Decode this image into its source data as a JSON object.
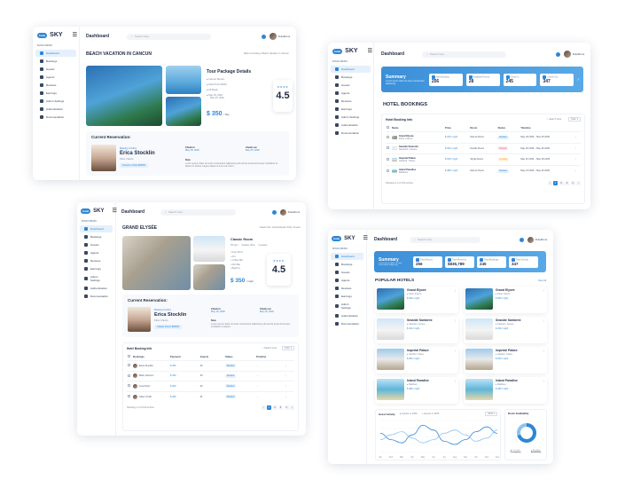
{
  "common": {
    "logo_text": "SKY",
    "logo_badge": "hotel",
    "menu_icon": "☰",
    "nav_title": "MAIN MENU",
    "nav_items": [
      "Dashboard",
      "Bookings",
      "Guests",
      "Agents",
      "Reviews",
      "Earnings",
      "Admin Settings",
      "Authentication",
      "Documentation"
    ],
    "topbar_title": "Dashboard",
    "search_placeholder": "Search here",
    "user_name": "Franklin A."
  },
  "card1": {
    "heading": "BEACH VACATION IN CANCUN",
    "breadcrumb": "Back to booking / Beach Vacation in Cancun",
    "tour_title": "Tour Package Details",
    "details": [
      "Cancun Mexico",
      "Most Price $1600",
      "All Meals",
      "May 18, 2026",
      "May 25, 2026"
    ],
    "rating": "4.5",
    "stars": "★★★★",
    "price": "$ 350",
    "price_unit": "/ Day",
    "reservation_title": "Current Reservation:",
    "guest_tag": "Booking Confirm",
    "guest_name": "Erica Stocklin",
    "guest_loc": "Paris, France",
    "room_btn": "Premium Suite   $350/N",
    "checkin_label": "Check in",
    "checkin_val": "May 18, 2026",
    "checkout_label": "Check out",
    "checkout_val": "May 25, 2026",
    "note_label": "Note",
    "note_text": "Lorem ipsum dolor sit amet consectetur adipiscing elit sed do eiusmod tempor incididunt ut labore et dolore magna aliqua ut enim ad minim."
  },
  "card2": {
    "summary_title": "Summary",
    "summary_sub": "Lorem ipsum dolor sit amet consectetur adipiscing",
    "stats": [
      {
        "label": "New Booking",
        "value": "256"
      },
      {
        "label": "Available Rooms",
        "value": "28"
      },
      {
        "label": "Check In",
        "value": "245"
      },
      {
        "label": "Check Out",
        "value": "347"
      }
    ],
    "section_title": "HOTEL BOOKINGS",
    "table_title": "Hotel Booking Info",
    "search_label": "Search here",
    "filter_label": "Filter",
    "columns": [
      "Name",
      "Price",
      "Room",
      "Status",
      "Timeline"
    ],
    "rows": [
      {
        "name": "Grand Elysée",
        "sub": "Paris, France",
        "price": "$ 320 / night",
        "room": "Deluxe Room",
        "status": "Booked",
        "timeline": "May 18 2026 – May 25 2026"
      },
      {
        "name": "Seaside Santorini",
        "sub": "Santorini, Greece",
        "price": "$ 320 / night",
        "room": "Double Room",
        "status": "Refund",
        "timeline": "May 20 2026 – May 26 2026"
      },
      {
        "name": "Imperial Palace",
        "sub": "Istanbul, Turkey",
        "price": "$ 320 / night",
        "room": "Single Room",
        "status": "Pending",
        "timeline": "May 22 2026 – May 28 2026"
      },
      {
        "name": "Island Paradise",
        "sub": "Maldives",
        "price": "$ 480 / night",
        "room": "Deluxe Room",
        "status": "Booked",
        "timeline": "May 24 2026 – May 30 2026"
      }
    ],
    "showing": "Showing 1-4 of 100 entries",
    "pages": [
      "‹",
      "1",
      "2",
      "3",
      "4",
      "›"
    ]
  },
  "card3": {
    "heading": "GRAND ELYSÉE",
    "breadcrumb": "Hotels Info / Grand Elysée Paris, France",
    "room_title": "Classic Room",
    "room_meta": [
      "35 sqm",
      "Garden View",
      "2 guests"
    ],
    "amenities": [
      "Free Wi-Fi",
      "A/C",
      "Coffee Bar",
      "Mini Bar",
      "Balcony"
    ],
    "rating": "4.5",
    "stars": "★★★★",
    "price": "$ 350",
    "price_unit": "/ night",
    "reservation_title": "Current Reservation:",
    "guest_tag": "Booking Confirm",
    "guest_name": "Erica Stocklin",
    "guest_loc": "Paris, France",
    "room_btn": "Classic Room   $350/N",
    "checkin_label": "Check in",
    "checkin_val": "May 18, 2026",
    "checkout_label": "Check out",
    "checkout_val": "May 25, 2026",
    "note_label": "Note",
    "note_text": "Lorem ipsum dolor sit amet consectetur adipiscing elit sed do eiusmod tempor incididunt ut labore.",
    "table_title": "Hotel Booking Info",
    "search_label": "Search here",
    "filter_label": "Filter",
    "columns": [
      "Bookings",
      "Payment",
      "Guests",
      "Status",
      "Timeline"
    ],
    "rows": [
      {
        "name": "Erica Stocklin",
        "pay": "$ 350",
        "guests": "02",
        "status": "Booked"
      },
      {
        "name": "Mark Johnson",
        "pay": "$ 420",
        "guests": "03",
        "status": "Booked"
      },
      {
        "name": "Lina Perez",
        "pay": "$ 350",
        "guests": "02",
        "status": "Booked"
      },
      {
        "name": "Adam Smith",
        "pay": "$ 380",
        "guests": "01",
        "status": "Booked"
      }
    ],
    "showing": "Showing 1-4 of 100 entries",
    "pages": [
      "‹",
      "1",
      "2",
      "3",
      "4",
      "›"
    ]
  },
  "card4": {
    "summary_title": "Summary",
    "summary_sub": "Lorem ipsum dolor sit amet consectetur adipiscing",
    "stats": [
      {
        "label": "Total Rooms",
        "value": "256"
      },
      {
        "label": "Total Revenue",
        "value": "$836,789"
      },
      {
        "label": "Total Bookings",
        "value": "245"
      },
      {
        "label": "Total Guests",
        "value": "347"
      }
    ],
    "section_title": "POPULAR HOTELS",
    "view_all": "View All",
    "hotels": [
      {
        "name": "Grand Elysée",
        "loc": "Paris, France",
        "price": "$ 350 / night"
      },
      {
        "name": "Grand Elysée",
        "loc": "Paris, France",
        "price": "$ 350 / night"
      },
      {
        "name": "Seaside Santorini",
        "loc": "Santorini, Greece",
        "price": "$ 320 / night"
      },
      {
        "name": "Seaside Santorini",
        "loc": "Santorini, Greece",
        "price": "$ 320 / night"
      },
      {
        "name": "Imperial Palace",
        "loc": "Istanbul, Turkey",
        "price": "$ 300 / night"
      },
      {
        "name": "Imperial Palace",
        "loc": "Istanbul, Turkey",
        "price": "$ 300 / night"
      },
      {
        "name": "Island Paradise",
        "loc": "Maldives",
        "price": "$ 480 / night"
      },
      {
        "name": "Island Paradise",
        "loc": "Maldives",
        "price": "$ 480 / night"
      }
    ],
    "activity_title": "Guest Activity",
    "legend1": "Guests in 2026",
    "legend2": "Guests in 2025",
    "period": "2026",
    "avail_title": "Room Availability",
    "avail_legend": [
      "Occupied",
      "Available"
    ],
    "avail_vals": [
      "Occupancy",
      "Availability"
    ],
    "chart_data": {
      "type": "line",
      "categories": [
        "Jan",
        "Feb",
        "Mar",
        "Apr",
        "May",
        "Jun",
        "Jul",
        "Aug",
        "Sep",
        "Oct",
        "Nov",
        "Dec"
      ],
      "series": [
        {
          "name": "Guests in 2026",
          "values": [
            60,
            40,
            30,
            55,
            85,
            70,
            35,
            25,
            40,
            65,
            80,
            60
          ]
        },
        {
          "name": "Guests in 2025",
          "values": [
            40,
            55,
            65,
            45,
            30,
            40,
            60,
            70,
            55,
            35,
            45,
            70
          ]
        }
      ],
      "ylim": [
        0,
        100
      ]
    },
    "donut": {
      "occupied": 0.7
    },
    "colors": {
      "primary": "#2f86d6",
      "secondary": "#8cc4f0"
    }
  }
}
